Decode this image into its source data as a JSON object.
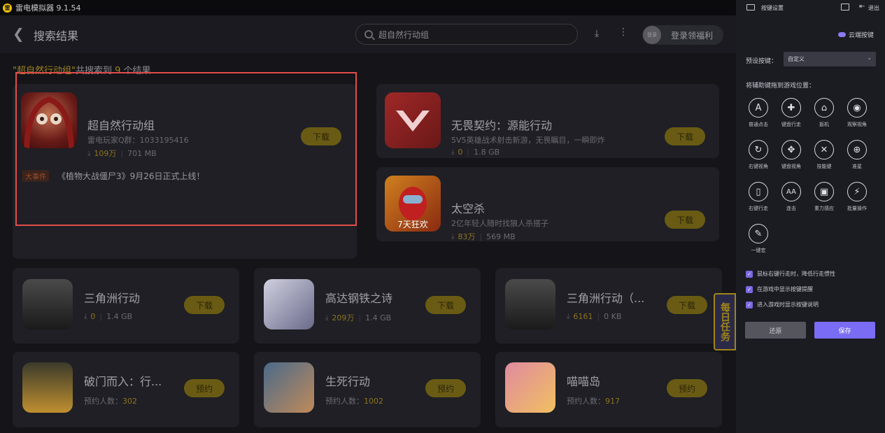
{
  "window": {
    "title": "雷电模拟器 9.1.54",
    "logo": "雷"
  },
  "header": {
    "back_icon": "back-icon",
    "title": "搜索结果",
    "search_value": "超自然行动组",
    "login_avatar": "登录",
    "login_text": "登录领福利"
  },
  "summary": {
    "query": "\"超自然行动组\"",
    "mid": "共搜索到",
    "count": "9",
    "suffix": "个结果"
  },
  "featured": [
    {
      "name": "超自然行动组",
      "desc": "雷电玩家Q群：1033195416",
      "count": "109万",
      "size": "701 MB",
      "button": "下载",
      "icon_color": "#7a2820"
    },
    {
      "name": "无畏契约：源能行动",
      "desc": "5V5英雄战术射击新游，无畏瞩目，一瞬即炸",
      "count": "0",
      "size": "1.8 GB",
      "button": "下载",
      "icon_color": "#8a2a2a"
    },
    {
      "name": "太空杀",
      "desc": "2亿年轻人随时找狼人杀搭子",
      "count": "83万",
      "size": "569 MB",
      "button": "下载",
      "icon_color": "#8a3a12"
    }
  ],
  "event": {
    "tag": "大事件",
    "text": "《植物大战僵尸3》9月26日正式上线！"
  },
  "grid": [
    {
      "name": "三角洲行动",
      "count": "0",
      "size": "1.4 GB",
      "button": "下载",
      "prefix": "",
      "icon_color": "#3a3a3a"
    },
    {
      "name": "高达钢铁之诗",
      "count": "209万",
      "size": "1.4 GB",
      "button": "下载",
      "prefix": "",
      "icon_color": "#4a4a5a"
    },
    {
      "name": "三角洲行动（...",
      "count": "6161",
      "size": "0 KB",
      "button": "下载",
      "prefix": "",
      "icon_color": "#3a3a3a"
    },
    {
      "name": "破门而入：行...",
      "count": "302",
      "size": "",
      "button": "预约",
      "prefix": "预约人数：",
      "icon_color": "#4a3a1a"
    },
    {
      "name": "生死行动",
      "count": "1002",
      "size": "",
      "button": "预约",
      "prefix": "预约人数：",
      "icon_color": "#3a4a5a"
    },
    {
      "name": "喵喵岛",
      "count": "917",
      "size": "",
      "button": "预约",
      "prefix": "预约人数：",
      "icon_color": "#8a4a5a"
    }
  ],
  "float_badge": "每日任务",
  "panel": {
    "title": "按键设置",
    "exit": "退出",
    "cloud": "云端按键",
    "preset_label": "预设按键：",
    "preset_value": "自定义",
    "drag_label": "将辅助键拖到游戏位置：",
    "keys": [
      {
        "label": "普通点击",
        "glyph": "A"
      },
      {
        "label": "键盘行走",
        "glyph": "✚"
      },
      {
        "label": "扳机",
        "glyph": "⌂"
      },
      {
        "label": "观察视角",
        "glyph": "◉"
      },
      {
        "label": "右键视角",
        "glyph": "↻"
      },
      {
        "label": "键盘视角",
        "glyph": "✥"
      },
      {
        "label": "技能键",
        "glyph": "✕"
      },
      {
        "label": "准星",
        "glyph": "⊕"
      },
      {
        "label": "右键行走",
        "glyph": "▯"
      },
      {
        "label": "连击",
        "glyph": "AA"
      },
      {
        "label": "重力感应",
        "glyph": "▣"
      },
      {
        "label": "批量操作",
        "glyph": "⚡"
      },
      {
        "label": "一键宏",
        "glyph": "✎"
      }
    ],
    "checks": [
      "鼠标右键行走时，降低行走惯性",
      "在游戏中显示按键提醒",
      "进入游戏时显示按键说明"
    ],
    "restore": "还原",
    "save": "保存"
  }
}
